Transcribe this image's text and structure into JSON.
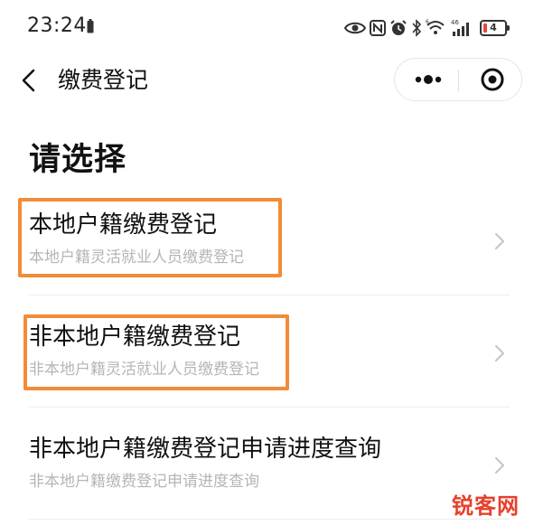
{
  "status_bar": {
    "time": "23:24",
    "network_label": "46",
    "battery_level": "4"
  },
  "nav": {
    "title": "缴费登记"
  },
  "page": {
    "heading": "请选择"
  },
  "options": [
    {
      "title": "本地户籍缴费登记",
      "subtitle": "本地户籍灵活就业人员缴费登记",
      "highlighted": true
    },
    {
      "title": "非本地户籍缴费登记",
      "subtitle": "非本地户籍灵活就业人员缴费登记",
      "highlighted": true
    },
    {
      "title": "非本地户籍缴费登记申请进度查询",
      "subtitle": "非本地户籍缴费登记申请进度查询",
      "highlighted": false
    }
  ],
  "watermark": "锐客网",
  "colors": {
    "highlight_border": "#f28c38",
    "subtitle_text": "#b5b5b5",
    "battery_low": "#e34a3c",
    "watermark": "#e8402a"
  },
  "icons": {
    "nav_back": "chevron-left-icon",
    "capsule_more": "more-dots-icon",
    "capsule_close": "target-close-icon",
    "option_arrow": "chevron-right-icon"
  }
}
